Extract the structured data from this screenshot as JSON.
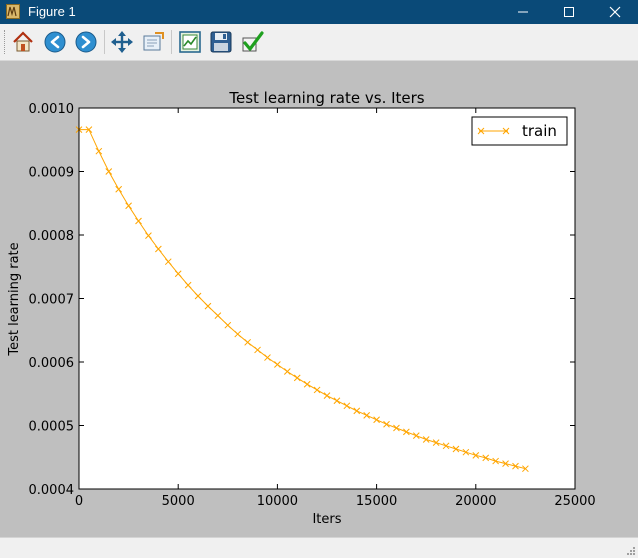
{
  "window": {
    "title": "Figure 1",
    "title_bar_color": "#0a4a78",
    "controls": [
      "minimize-icon",
      "maximize-icon",
      "close-icon"
    ]
  },
  "toolbar": {
    "buttons": [
      {
        "name": "home",
        "icon": "home-icon"
      },
      {
        "name": "back",
        "icon": "back-arrow-icon"
      },
      {
        "name": "forward",
        "icon": "forward-arrow-icon"
      },
      {
        "name": "pan",
        "icon": "pan-move-icon"
      },
      {
        "name": "zoom",
        "icon": "zoom-to-rect-icon"
      },
      {
        "name": "subplots",
        "icon": "subplots-configure-icon"
      },
      {
        "name": "save",
        "icon": "floppy-save-icon"
      },
      {
        "name": "edit",
        "icon": "checkmark-edit-icon"
      }
    ]
  },
  "chart_data": {
    "type": "line",
    "title": "Test learning rate  vs. Iters",
    "xlabel": "Iters",
    "ylabel": "Test learning rate",
    "xlim": [
      0,
      25000
    ],
    "ylim": [
      0.0004,
      0.001
    ],
    "xticks": [
      "0",
      "5000",
      "10000",
      "15000",
      "20000",
      "25000"
    ],
    "yticks": [
      "0.0004",
      "0.0005",
      "0.0006",
      "0.0007",
      "0.0008",
      "0.0009",
      "0.0010"
    ],
    "grid": false,
    "legend": {
      "position": "top-right",
      "entries": [
        "train"
      ]
    },
    "marker": "x",
    "series": [
      {
        "name": "train",
        "color": "#ffa500",
        "x": [
          0,
          500,
          1000,
          1500,
          2000,
          2500,
          3000,
          3500,
          4000,
          4500,
          5000,
          5500,
          6000,
          6500,
          7000,
          7500,
          8000,
          8500,
          9000,
          9500,
          10000,
          10500,
          11000,
          11500,
          12000,
          12500,
          13000,
          13500,
          14000,
          14500,
          15000,
          15500,
          16000,
          16500,
          17000,
          17500,
          18000,
          18500,
          19000,
          19500,
          20000,
          20500,
          21000,
          21500,
          22000,
          22500
        ],
        "y": [
          0.000966,
          0.000966,
          0.000932,
          0.0009,
          0.000872,
          0.000846,
          0.000822,
          0.000799,
          0.000778,
          0.000758,
          0.000739,
          0.000721,
          0.000704,
          0.000688,
          0.000673,
          0.000658,
          0.000644,
          0.000631,
          0.000619,
          0.000607,
          0.000596,
          0.000585,
          0.000575,
          0.000565,
          0.000556,
          0.000547,
          0.000539,
          0.000531,
          0.000523,
          0.000516,
          0.000509,
          0.000502,
          0.000496,
          0.00049,
          0.000484,
          0.000478,
          0.000473,
          0.000468,
          0.000463,
          0.000458,
          0.000453,
          0.000449,
          0.000444,
          0.00044,
          0.000436,
          0.000432
        ]
      }
    ]
  }
}
